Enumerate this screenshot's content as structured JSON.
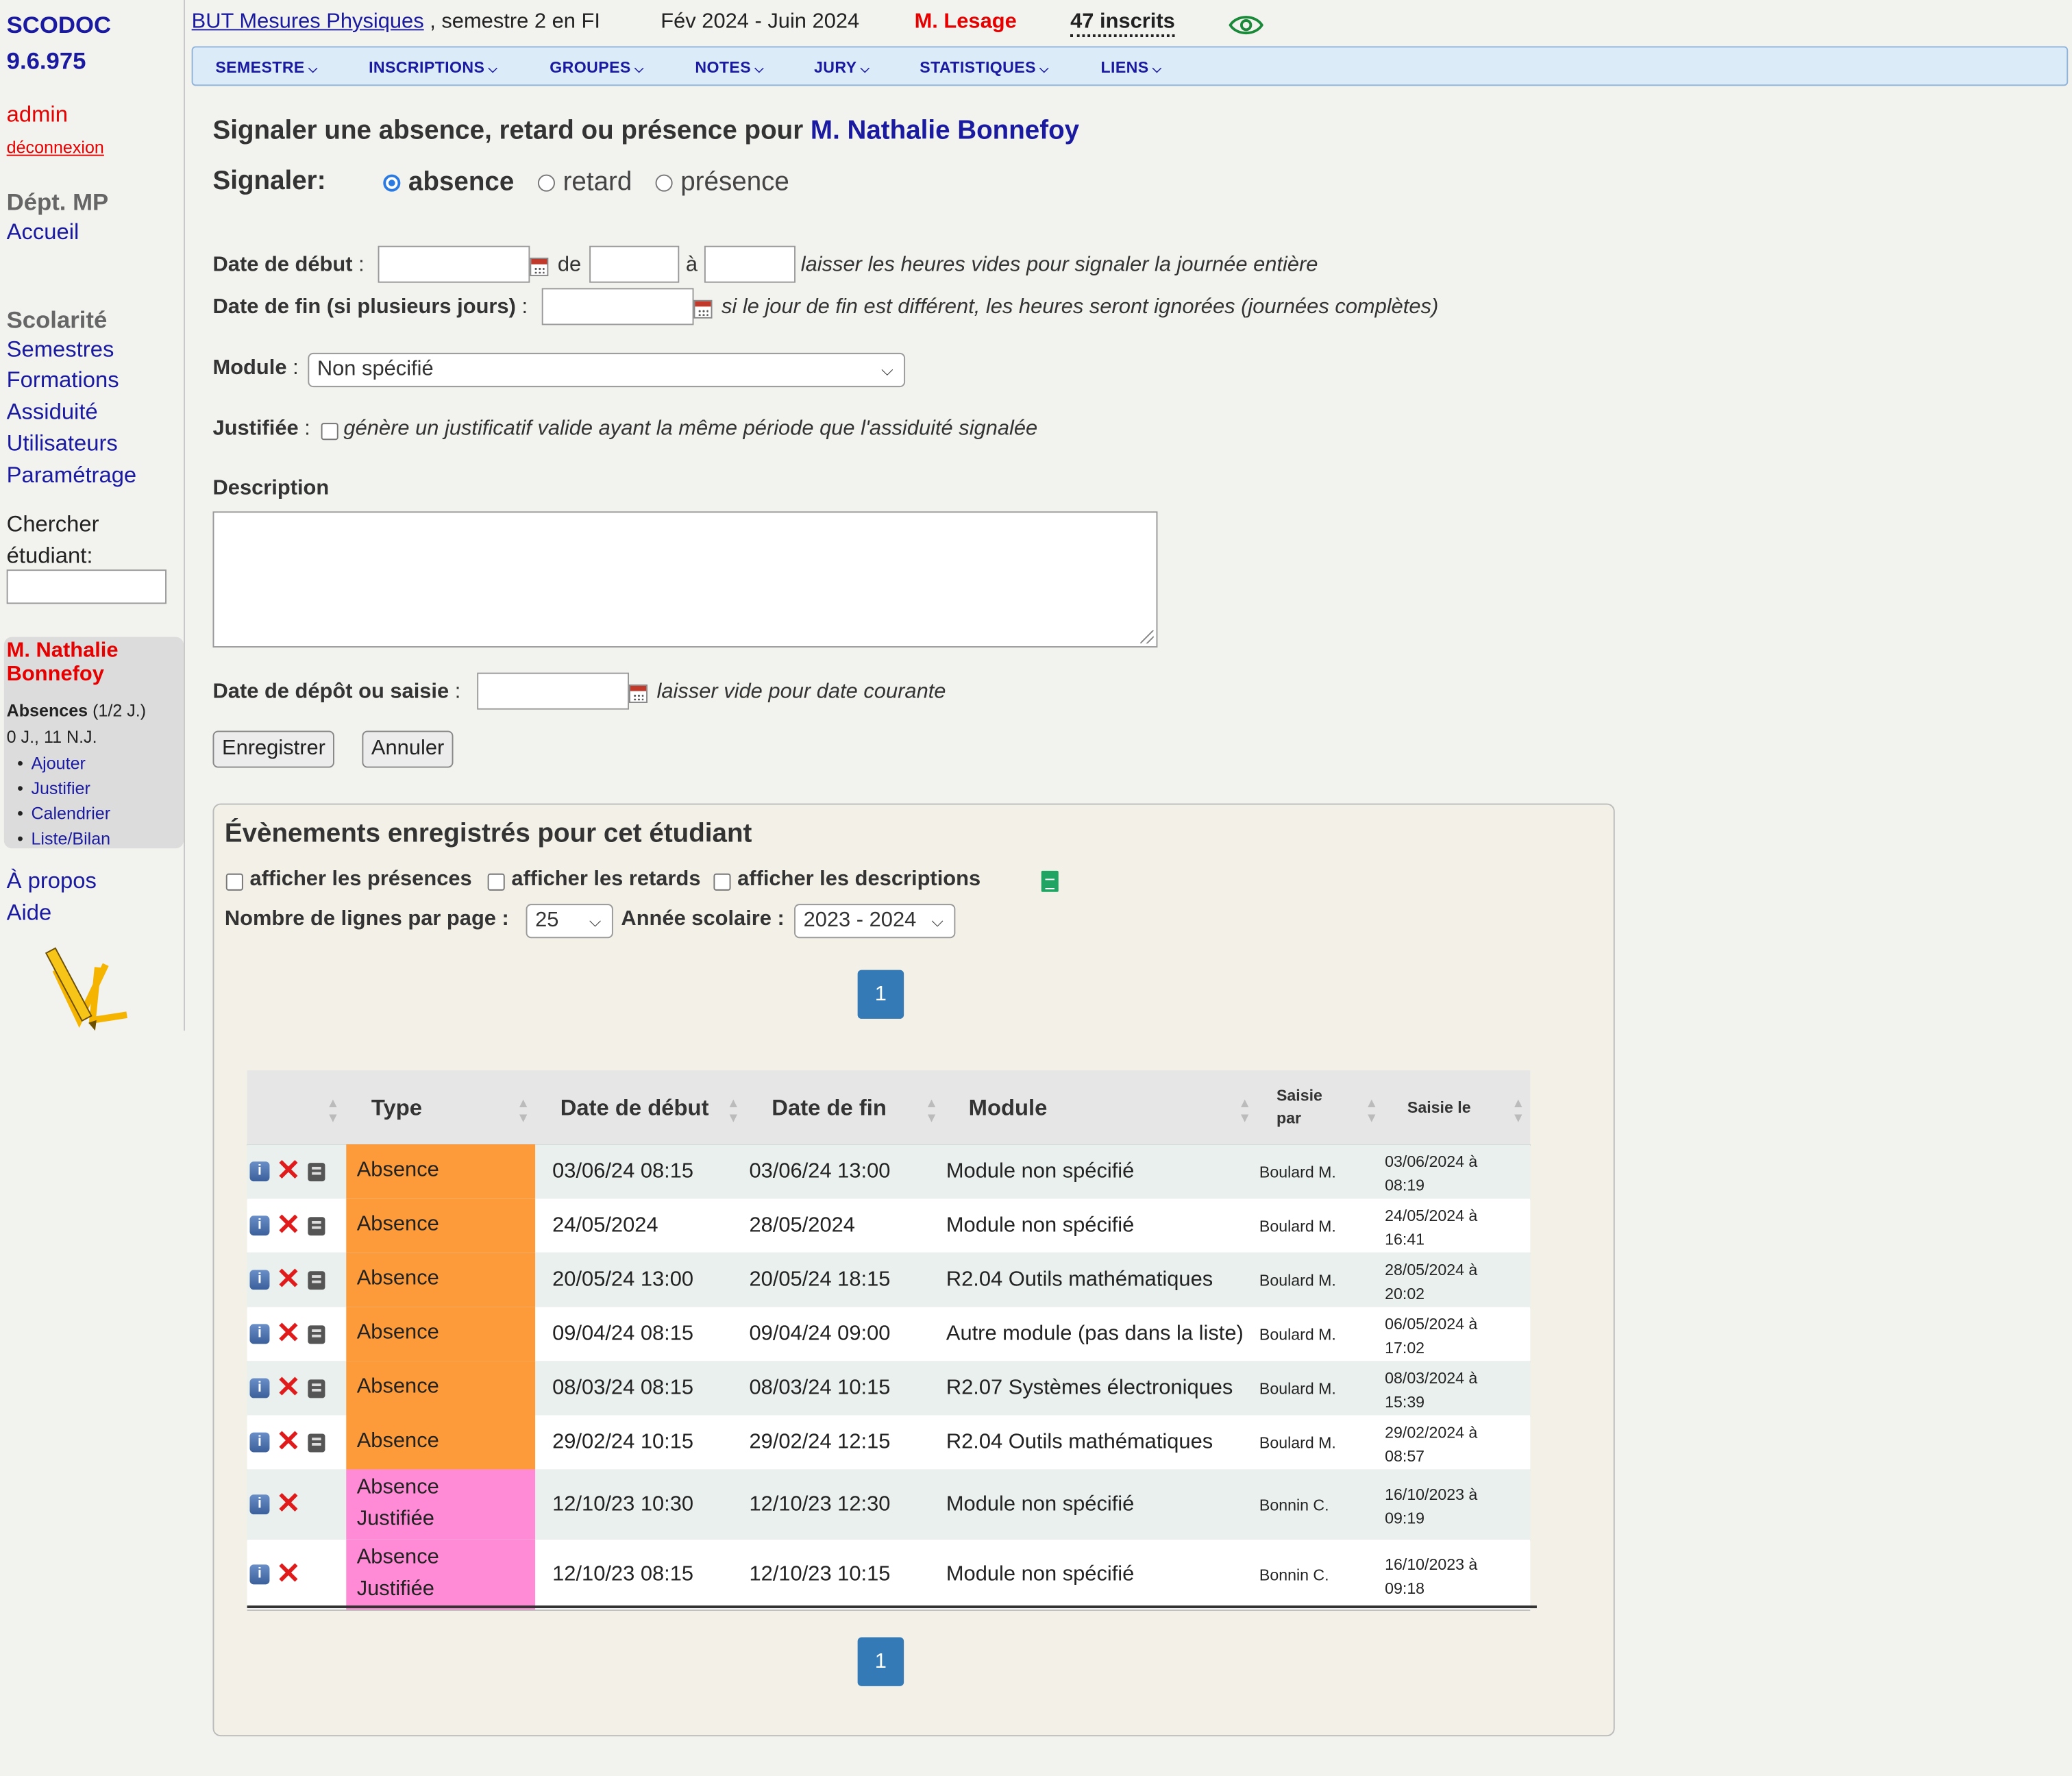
{
  "app": {
    "name": "SCODOC",
    "version": "9.6.975"
  },
  "user": {
    "name": "admin",
    "logout": "déconnexion"
  },
  "dept": {
    "label": "Dépt. MP",
    "home": "Accueil"
  },
  "scolarite": {
    "title": "Scolarité",
    "links": [
      "Semestres",
      "Formations",
      "Assiduité",
      "Utilisateurs",
      "Paramétrage"
    ]
  },
  "search": {
    "label_line1": "Chercher",
    "label_line2": "étudiant:"
  },
  "student_box": {
    "name_line1": "M. Nathalie",
    "name_line2": "Bonnefoy",
    "abs_label": "Absences",
    "abs_unit": " (1/2 J.)",
    "abs_counts": "0 J., 11 N.J.",
    "links": [
      "Ajouter",
      "Justifier",
      "Calendrier",
      "Liste/Bilan"
    ]
  },
  "footer_links": [
    "À propos",
    "Aide"
  ],
  "header": {
    "formation": "BUT Mesures Physiques",
    "semestre": " , semestre 2 en FI",
    "dates": "Fév 2024 - Juin 2024",
    "responsable": "M. Lesage",
    "inscrits": "47 inscrits"
  },
  "menu": [
    "SEMESTRE",
    "INSCRIPTIONS",
    "GROUPES",
    "NOTES",
    "JURY",
    "STATISTIQUES",
    "LIENS"
  ],
  "form": {
    "title_prefix": "Signaler une absence, retard ou présence pour ",
    "title_student": "M. Nathalie Bonnefoy",
    "signaler_label": "Signaler:",
    "options": [
      "absence",
      "retard",
      "présence"
    ],
    "selected": "absence",
    "date_debut_label": "Date de début",
    "colon": " :",
    "de": "de",
    "a": "à",
    "hint_hours": "laisser les heures vides pour signaler la journée entière",
    "date_fin_label": "Date de fin (si plusieurs jours)",
    "hint_fin": "si le jour de fin est différent, les heures seront ignorées (journées complètes)",
    "module_label": "Module",
    "module_value": "Non spécifié",
    "justifiee_label": "Justifiée",
    "justifiee_hint": "génère un justificatif valide ayant la même période que l'assiduité signalée",
    "description_label": "Description",
    "depot_label": "Date de dépôt ou saisie",
    "depot_hint": "laisser vide pour date courante",
    "save": "Enregistrer",
    "cancel": "Annuler"
  },
  "events": {
    "title": "Évènements enregistrés pour cet étudiant",
    "opt_presences": "afficher les présences",
    "opt_retards": "afficher les retards",
    "opt_descriptions": "afficher les descriptions",
    "lines_label": "Nombre de lignes par page :",
    "lines_value": "25",
    "year_label": "Année scolaire :",
    "year_value": "2023 - 2024",
    "page": "1",
    "columns": [
      "Type",
      "Date de début",
      "Date de fin",
      "Module",
      "Saisie par",
      "Saisie le"
    ],
    "rows": [
      {
        "type": "Absence",
        "debut": "03/06/24 08:15",
        "fin": "03/06/24 13:00",
        "module": "Module non spécifié",
        "par": "Boulard M.",
        "le1": "03/06/2024 à",
        "le2": "08:19",
        "color": "#fd9a3a"
      },
      {
        "type": "Absence",
        "debut": "24/05/2024",
        "fin": "28/05/2024",
        "module": "Module non spécifié",
        "par": "Boulard M.",
        "le1": "24/05/2024 à",
        "le2": "16:41",
        "color": "#fd9a3a"
      },
      {
        "type": "Absence",
        "debut": "20/05/24 13:00",
        "fin": "20/05/24 18:15",
        "module": "R2.04 Outils mathématiques",
        "par": "Boulard M.",
        "le1": "28/05/2024 à",
        "le2": "20:02",
        "color": "#fd9a3a"
      },
      {
        "type": "Absence",
        "debut": "09/04/24 08:15",
        "fin": "09/04/24 09:00",
        "module": "Autre module (pas dans la liste)",
        "par": "Boulard M.",
        "le1": "06/05/2024 à",
        "le2": "17:02",
        "color": "#fd9a3a"
      },
      {
        "type": "Absence",
        "debut": "08/03/24 08:15",
        "fin": "08/03/24 10:15",
        "module": "R2.07 Systèmes électroniques",
        "par": "Boulard M.",
        "le1": "08/03/2024 à",
        "le2": "15:39",
        "color": "#fd9a3a"
      },
      {
        "type": "Absence",
        "debut": "29/02/24 10:15",
        "fin": "29/02/24 12:15",
        "module": "R2.04 Outils mathématiques",
        "par": "Boulard M.",
        "le1": "29/02/2024 à",
        "le2": "08:57",
        "color": "#fd9a3a"
      },
      {
        "type": "Absence",
        "type2": "Justifiée",
        "debut": "12/10/23 10:30",
        "fin": "12/10/23 12:30",
        "module": "Module non spécifié",
        "par": "Bonnin C.",
        "le1": "16/10/2023 à",
        "le2": "09:19",
        "color": "#ff8ad6"
      },
      {
        "type": "Absence",
        "type2": "Justifiée",
        "debut": "12/10/23 08:15",
        "fin": "12/10/23 10:15",
        "module": "Module non spécifié",
        "par": "Bonnin C.",
        "le1": "16/10/2023 à",
        "le2": "09:18",
        "color": "#ff8ad6"
      }
    ]
  }
}
